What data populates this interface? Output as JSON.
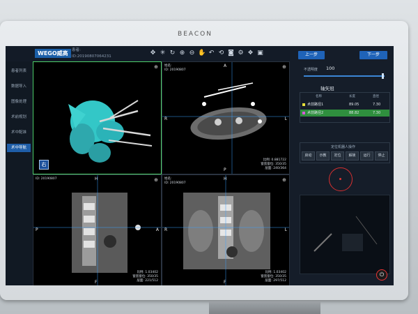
{
  "monitor": {
    "brand": "BEACON"
  },
  "topbar": {
    "logo": "WEGO威高",
    "patient_label": "患者:",
    "patient_id": "ID:20190807064231",
    "tools": [
      "move-icon",
      "crosshair-icon",
      "rotate-icon",
      "zoom-in-icon",
      "zoom-out-icon",
      "pan-icon",
      "undo-icon",
      "reset-icon",
      "snapshot-icon",
      "settings-icon",
      "layers-icon",
      "window-icon"
    ]
  },
  "nav": {
    "items": [
      {
        "label": "患者列表",
        "active": false
      },
      {
        "label": "数据导入",
        "active": false
      },
      {
        "label": "图像处理",
        "active": false
      },
      {
        "label": "术前规划",
        "active": false
      },
      {
        "label": "术中配准",
        "active": false
      },
      {
        "label": "术中导航",
        "active": true
      }
    ]
  },
  "viewports": {
    "vp1": {
      "badge": "右"
    },
    "vp2": {
      "name_label": "姓名:",
      "date": "ID: 20190807",
      "orient": {
        "top": "A",
        "left": "R",
        "right": "L",
        "bottom": "P"
      },
      "info": [
        "比例: 0.881722",
        "窗宽窗位: 350/35",
        "层面: 240/364"
      ]
    },
    "vp3": {
      "date": "ID: 20190807",
      "orient": {
        "top": "H",
        "left": "P",
        "right": "A",
        "bottom": "F"
      },
      "info": [
        "比例: 1.03402",
        "窗宽窗位: 350/35",
        "层面: 221/512"
      ]
    },
    "vp4": {
      "name_label": "姓名:",
      "date": "ID: 20190807",
      "orient": {
        "top": "H",
        "left": "R",
        "right": "L",
        "bottom": "F"
      },
      "info": [
        "比例: 1.03402",
        "窗宽窗位: 350/35",
        "层面: 297/512"
      ]
    }
  },
  "panel": {
    "prev_label": "上一步",
    "next_label": "下一步",
    "slider_label": "不透明度",
    "slider_value": "100",
    "slider_level": 1.0,
    "section_title": "轴矢冠",
    "table": {
      "headers": [
        "名称",
        "长度",
        "直径"
      ],
      "rows": [
        {
          "name": "术前路径1",
          "length": "89.05",
          "diameter": "7.30",
          "color": "#e8e03a",
          "selected": false
        },
        {
          "name": "术前路径2",
          "length": "88.82",
          "diameter": "7.30",
          "color": "#d65ad8",
          "selected": true
        }
      ]
    },
    "robot_title": "定位机器人操作",
    "robot_buttons": [
      "启动",
      "示教",
      "定位",
      "解锁",
      "运行",
      "停止"
    ]
  }
}
